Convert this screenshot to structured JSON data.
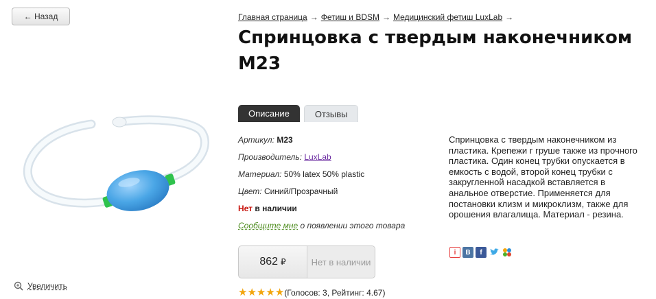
{
  "back": {
    "label": "← Назад"
  },
  "breadcrumb": {
    "items": [
      "Главная страница",
      "Фетиш и BDSM",
      "Медицинский фетиш LuxLab"
    ],
    "separator": "→"
  },
  "title": "Спринцовка с твердым наконечником M23",
  "tabs": [
    {
      "label": "Описание",
      "active": true
    },
    {
      "label": "Отзывы",
      "active": false
    }
  ],
  "props": {
    "article_label": "Артикул:",
    "article_value": "M23",
    "maker_label": "Производитель:",
    "maker_value": "LuxLab",
    "material_label": "Материал:",
    "material_value": "50% latex 50% plastic",
    "color_label": "Цвет:",
    "color_value": "Синий/Прозрачный",
    "stock_red": "Нет",
    "stock_rest": "в наличии",
    "notify_link": "Сообщите мне",
    "notify_rest": "о появлении этого товара"
  },
  "price": {
    "value": "862",
    "currency": "₽",
    "button": "Нет в наличии"
  },
  "rating": {
    "stars": 5,
    "text": "(Голосов: 3, Рейтинг: 4.67)"
  },
  "description": "Спринцовка с твердым наконечником из пластика. Крепежи г груше также из прочного пластика. Один конец трубки опускается в емкость с водой, второй конец трубки с закругленной насадкой вставляется в анальное отверстие. Применяется для постановки клизм и микроклизм, также для орошения влагалища. Материал - резина.",
  "zoom": {
    "label": "Увеличить"
  },
  "share_icons": [
    "yandex-icon",
    "vk-icon",
    "facebook-icon",
    "twitter-icon",
    "mymail-icon"
  ],
  "colors": {
    "bulb": "#4aa6e6",
    "stock_red": "#c8160f",
    "notify_green": "#4a8a1a",
    "star": "#f2a50d"
  }
}
